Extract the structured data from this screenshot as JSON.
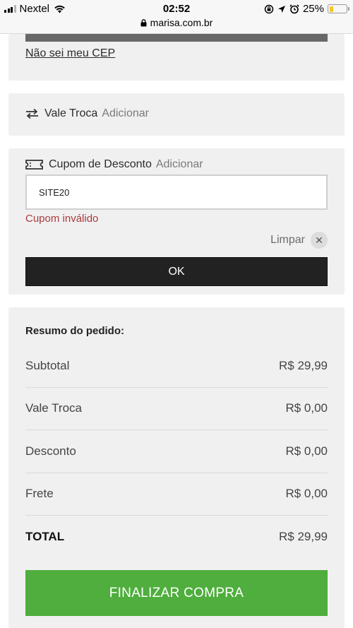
{
  "status_bar": {
    "carrier": "Nextel",
    "time": "02:52",
    "url": "marisa.com.br",
    "battery_percent": "25%",
    "battery_level": 0.25
  },
  "cep": {
    "link": "Não sei meu CEP"
  },
  "vale_troca": {
    "label": "Vale Troca",
    "action": "Adicionar",
    "icon": "swap-arrows-icon"
  },
  "cupom": {
    "label": "Cupom de Desconto",
    "action": "Adicionar",
    "icon": "ticket-icon",
    "input_value": "SITE20",
    "error": "Cupom inválido",
    "clear_label": "Limpar",
    "clear_icon": "close-icon",
    "submit_label": "OK"
  },
  "resumo": {
    "title": "Resumo do pedido:",
    "rows": [
      {
        "label": "Subtotal",
        "value": "R$ 29,99"
      },
      {
        "label": "Vale Troca",
        "value": "R$ 0,00"
      },
      {
        "label": "Desconto",
        "value": "R$ 0,00"
      },
      {
        "label": "Frete",
        "value": "R$ 0,00"
      },
      {
        "label": "TOTAL",
        "value": "R$ 29,99"
      }
    ],
    "finalize_label": "FINALIZAR COMPRA"
  },
  "colors": {
    "card_bg": "#f1f0f1",
    "error": "#a93a3a",
    "ok_button": "#222222",
    "finalize_button": "#4fae3d"
  }
}
